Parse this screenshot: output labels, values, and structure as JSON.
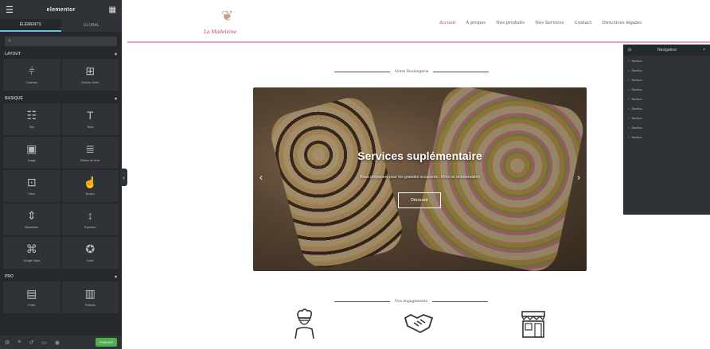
{
  "editor": {
    "title": "elementor",
    "tabs": [
      "ÉLÉMENTS",
      "GLOBAL"
    ],
    "search_icon": "search-icon",
    "categories": [
      {
        "label": "LAYOUT",
        "widgets": [
          {
            "icon": "columns-icon",
            "label": "Colonnes"
          },
          {
            "icon": "grid-icon",
            "label": "Flexbox Grille"
          }
        ]
      },
      {
        "label": "BASIQUE",
        "widgets": [
          {
            "icon": "heading-icon",
            "label": "Titre"
          },
          {
            "icon": "text-icon",
            "label": "Texte"
          },
          {
            "icon": "image-icon",
            "label": "Image"
          },
          {
            "icon": "text-editor-icon",
            "label": "Éditeur de texte"
          },
          {
            "icon": "video-icon",
            "label": "Vidéo"
          },
          {
            "icon": "button-icon",
            "label": "Bouton"
          },
          {
            "icon": "divider-icon",
            "label": "Séparateur"
          },
          {
            "icon": "spacer-icon",
            "label": "Espaceur"
          },
          {
            "icon": "map-icon",
            "label": "Google Maps"
          },
          {
            "icon": "icon-icon",
            "label": "Icône"
          }
        ]
      },
      {
        "label": "PRO",
        "widgets": [
          {
            "icon": "posts-icon",
            "label": "Posts"
          },
          {
            "icon": "portfolio-icon",
            "label": "Portfolio"
          }
        ]
      }
    ],
    "publish_label": "PUBLIER"
  },
  "site": {
    "logo_name": "La Madeleine",
    "nav": [
      "Accueil",
      "À propos",
      "Nos produits",
      "Nos Services",
      "Contact",
      "Directives légales"
    ],
    "active_nav": 0
  },
  "section1": {
    "title": "Notre Boulangerie"
  },
  "slider": {
    "title": "Services suplémentaire",
    "subtitle": "Nous préparons pour les grandes occasions : fêtes ou anniversaires",
    "button": "Découvrir"
  },
  "section2": {
    "title": "Nos engagements"
  },
  "navigator": {
    "title": "Navigateur",
    "rows": [
      "Section",
      "Section",
      "Section",
      "Section",
      "Section",
      "Section",
      "Section",
      "Section",
      "Section"
    ]
  },
  "colors": {
    "accent": "#c23a6b",
    "border": "#ee9ed9",
    "panel": "#26292c"
  }
}
